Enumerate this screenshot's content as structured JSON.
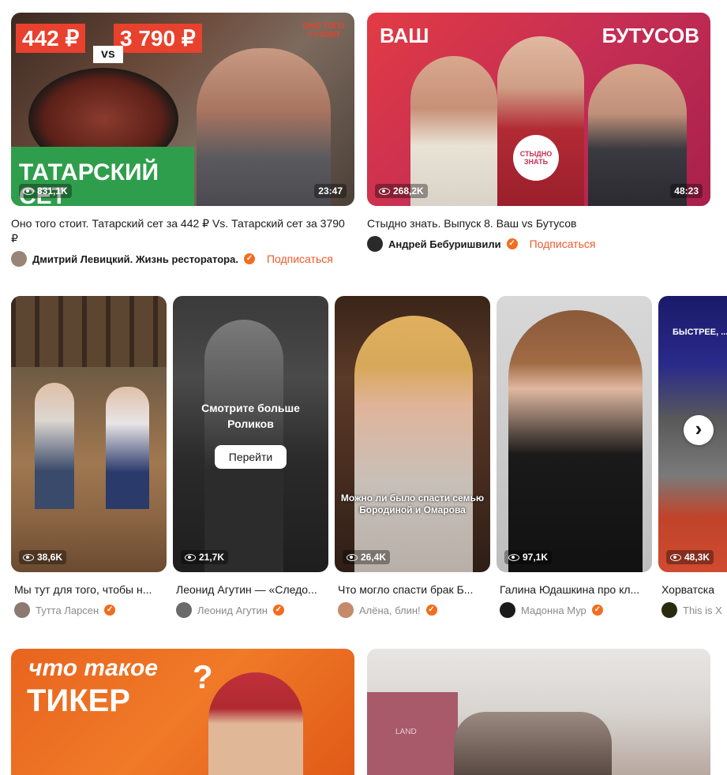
{
  "videos_top": [
    {
      "title": "Оно того стоит. Татарский сет за 442 ₽ Vs. Татарский сет за 3790 ₽",
      "channel": "Дмитрий Левицкий. Жизнь ресторатора.",
      "views": "831,1K",
      "duration": "23:47",
      "subscribe": "Подписаться",
      "thumb_text": {
        "price_left": "442 ₽",
        "price_right": "3 790 ₽",
        "vs": "vs",
        "stamp": "ОНО ТОГО ? СТОИТ",
        "banner": "ТАТАРСКИЙ СЕТ"
      }
    },
    {
      "title": "Стыдно знать. Выпуск 8. Ваш vs Бутусов",
      "channel": "Андрей Бебуришвили",
      "views": "268,2K",
      "duration": "48:23",
      "subscribe": "Подписаться",
      "thumb_text": {
        "left": "ВАШ",
        "right": "БУТУСОВ",
        "logo": "СТЫДНО ЗНАТЬ"
      }
    }
  ],
  "shorts": [
    {
      "title": "Мы тут для того, чтобы н...",
      "channel": "Тутта Ларсен",
      "views": "38,6K"
    },
    {
      "title": "Леонид Агутин — «Следо...",
      "channel": "Леонид Агутин",
      "views": "21,7K",
      "overlay": "Смотрите больше Роликов",
      "button": "Перейти"
    },
    {
      "title": "Что могло спасти брак Б...",
      "channel": "Алёна, блин!",
      "views": "26,4K",
      "caption": "Можно ли было спасти семью Бородиной и Омарова"
    },
    {
      "title": "Галина Юдашкина про кл...",
      "channel": "Мадонна Мур",
      "views": "97,1K"
    },
    {
      "title": "Хорватска",
      "channel": "This is X",
      "views": "48,3K",
      "thumb_text": "БЫСТРЕЕ, ... М"
    }
  ],
  "videos_bottom": [
    {
      "thumb_text": {
        "line1": "что такое",
        "line2": "ТИКЕР",
        "q": "?"
      }
    },
    {
      "thumb_text": {
        "sign": "LAND"
      }
    }
  ],
  "next_arrow": "›",
  "colors": {
    "accent": "#f0592a",
    "verified": "#f26d1f"
  }
}
